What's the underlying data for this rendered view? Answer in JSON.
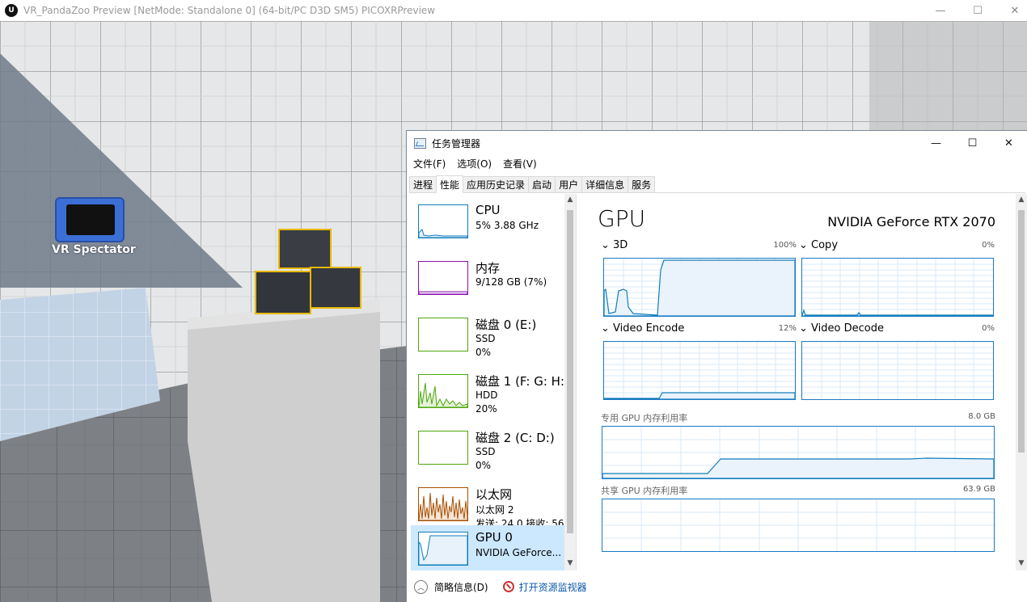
{
  "game_window": {
    "logo_text": "U",
    "title": "VR_PandaZoo Preview [NetMode: Standalone 0]  (64-bit/PC D3D SM5) PICOXRPreview",
    "minimize": "—",
    "maximize": "☐",
    "close": "✕"
  },
  "scene": {
    "spectator_label": "VR Spectator"
  },
  "task_manager": {
    "title": "任务管理器",
    "minimize": "—",
    "maximize": "☐",
    "close": "✕",
    "menu": [
      "文件(F)",
      "选项(O)",
      "查看(V)"
    ],
    "tabs": [
      "进程",
      "性能",
      "应用历史记录",
      "启动",
      "用户",
      "详细信息",
      "服务"
    ],
    "active_tab": "性能",
    "resources": [
      {
        "name": "CPU",
        "line1": "5% 3.88 GHz",
        "line2": "",
        "color": "#117dbb"
      },
      {
        "name": "内存",
        "line1": "9/128 GB (7%)",
        "line2": "",
        "color": "#8b12ae"
      },
      {
        "name": "磁盘 0 (E:)",
        "line1": "SSD",
        "line2": "0%",
        "color": "#4da60c"
      },
      {
        "name": "磁盘 1 (F: G: H:",
        "line1": "HDD",
        "line2": "20%",
        "color": "#4da60c"
      },
      {
        "name": "磁盘 2 (C: D:)",
        "line1": "SSD",
        "line2": "0%",
        "color": "#4da60c"
      },
      {
        "name": "以太网",
        "line1": "以太网 2",
        "line2": "发送: 24.0  接收: 56.",
        "color": "#a74f01"
      },
      {
        "name": "GPU 0",
        "line1": "NVIDIA GeForce...",
        "line2": "",
        "color": "#117dbb"
      }
    ],
    "selected_resource": "GPU 0",
    "gpu": {
      "title": "GPU",
      "model": "NVIDIA GeForce RTX 2070",
      "engines": [
        {
          "label": "3D",
          "percent": "100%"
        },
        {
          "label": "Copy",
          "percent": "0%"
        },
        {
          "label": "Video Encode",
          "percent": "12%"
        },
        {
          "label": "Video Decode",
          "percent": "0%"
        }
      ],
      "dedicated_label": "专用 GPU 内存利用率",
      "dedicated_max": "8.0 GB",
      "shared_label": "共享 GPU 内存利用率",
      "shared_max": "63.9 GB"
    },
    "footer": {
      "fewer_details": "简略信息(D)",
      "resource_monitor": "打开资源监视器"
    }
  }
}
